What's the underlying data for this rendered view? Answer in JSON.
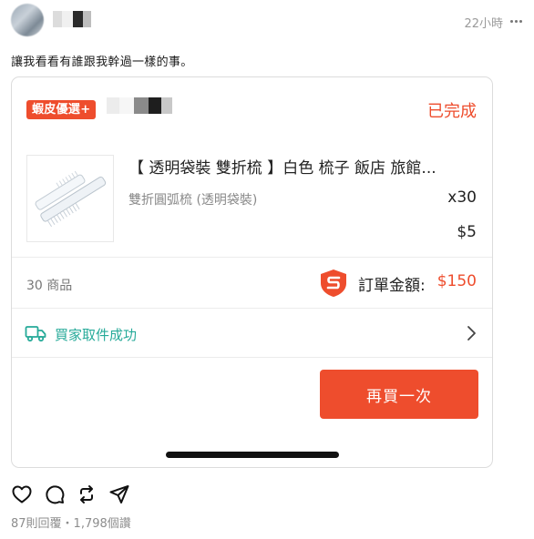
{
  "post": {
    "time": "22小時",
    "text": "讓我看看有誰跟我幹過一樣的事。",
    "stats": "87則回覆・1,798個讚",
    "actions": [
      "heart-icon",
      "comment-icon",
      "repost-icon",
      "share-icon"
    ]
  },
  "order": {
    "shop_badge": "蝦皮優選+",
    "status": "已完成",
    "product": {
      "title": "【 透明袋裝 雙折梳 】白色 梳子 飯店 旅館...",
      "variant": "雙折圓弧梳 (透明袋裝)",
      "quantity": "x30",
      "price": "$5"
    },
    "item_count": "30 商品",
    "total_label": "訂單金額:",
    "total_value": "$150",
    "shipping_status": "買家取件成功",
    "rebuy_label": "再買一次"
  },
  "colors": {
    "brand": "#ee4d2d",
    "shipping": "#26aa99"
  }
}
